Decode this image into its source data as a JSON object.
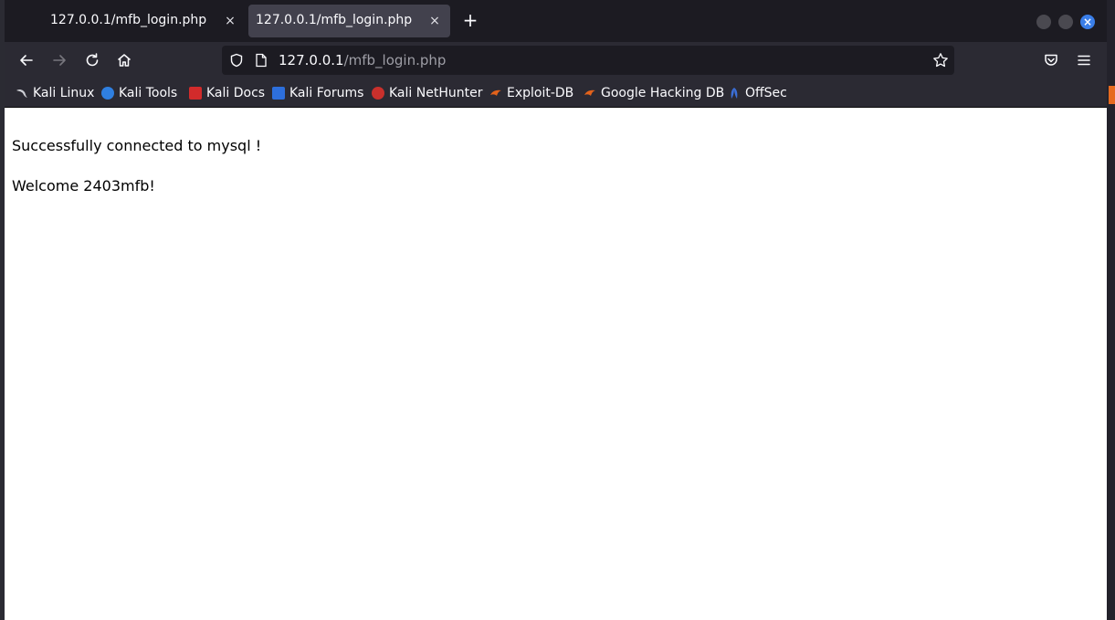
{
  "tabs": [
    {
      "title": "127.0.0.1/mfb_login.php",
      "active": false
    },
    {
      "title": "127.0.0.1/mfb_login.php",
      "active": true
    }
  ],
  "tab_close_glyph": "×",
  "new_tab_glyph": "+",
  "window_close_glyph": "×",
  "address": {
    "host": "127.0.0.1",
    "path": "/mfb_login.php"
  },
  "bookmarks": [
    {
      "label": "Kali Linux",
      "icon": "kali-dragon-icon",
      "color": "#1d1d1d"
    },
    {
      "label": "Kali Tools",
      "icon": "kali-tools-icon",
      "color": "#2f7fe0"
    },
    {
      "label": "Kali Docs",
      "icon": "kali-docs-icon",
      "color": "#d22b2b"
    },
    {
      "label": "Kali Forums",
      "icon": "kali-forums-icon",
      "color": "#2d6fdc"
    },
    {
      "label": "Kali NetHunter",
      "icon": "nethunter-icon",
      "color": "#c9302c"
    },
    {
      "label": "Exploit-DB",
      "icon": "exploit-db-icon",
      "color": "#e2621b"
    },
    {
      "label": "Google Hacking DB",
      "icon": "ghdb-icon",
      "color": "#e2621b"
    },
    {
      "label": "OffSec",
      "icon": "offsec-icon",
      "color": "#3b6fd8"
    }
  ],
  "page": {
    "line1": "Successfully connected to mysql !",
    "line2": "Welcome 2403mfb!"
  }
}
